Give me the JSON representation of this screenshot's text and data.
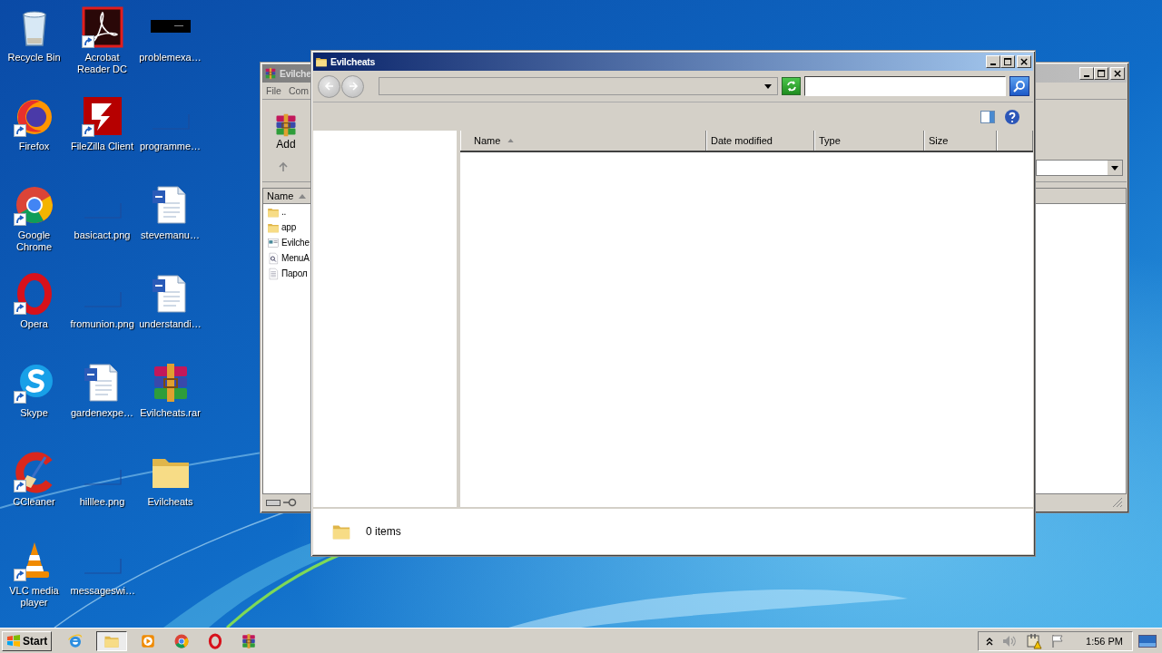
{
  "desktop": {
    "icons": [
      {
        "label": "Recycle Bin",
        "kind": "recycle-bin",
        "shortcut": false
      },
      {
        "label": "Acrobat Reader DC",
        "kind": "pdf",
        "shortcut": true
      },
      {
        "label": "problemexa…",
        "kind": "thumb-dark",
        "shortcut": false
      },
      {
        "label": "Firefox",
        "kind": "fox",
        "shortcut": true
      },
      {
        "label": "FileZilla Client",
        "kind": "ftp",
        "shortcut": true
      },
      {
        "label": "programme…",
        "kind": "thumb",
        "shortcut": false
      },
      {
        "label": "Google Chrome",
        "kind": "chrome",
        "shortcut": true
      },
      {
        "label": "basicact.png",
        "kind": "thumb",
        "shortcut": false
      },
      {
        "label": "stevemanu…",
        "kind": "document",
        "shortcut": false
      },
      {
        "label": "Opera",
        "kind": "opera",
        "shortcut": true
      },
      {
        "label": "fromunion.png",
        "kind": "thumb",
        "shortcut": false
      },
      {
        "label": "understandi…",
        "kind": "document",
        "shortcut": false
      },
      {
        "label": "Skype",
        "kind": "skype",
        "shortcut": true
      },
      {
        "label": "gardenexpe…",
        "kind": "document",
        "shortcut": false
      },
      {
        "label": "Evilcheats.rar",
        "kind": "archive",
        "shortcut": false
      },
      {
        "label": "CCleaner",
        "kind": "cleaner",
        "shortcut": true
      },
      {
        "label": "hilllee.png",
        "kind": "thumb",
        "shortcut": false
      },
      {
        "label": "Evilcheats",
        "kind": "folder",
        "shortcut": false
      },
      {
        "label": "VLC media player",
        "kind": "cone",
        "shortcut": true
      },
      {
        "label": "messageswi…",
        "kind": "thumb",
        "shortcut": false
      }
    ]
  },
  "archive_window": {
    "title": "Evilche",
    "menu": [
      "File",
      "Com"
    ],
    "toolbar_button": "Add",
    "column": "Name",
    "files": [
      {
        "name": "..",
        "kind": "folder"
      },
      {
        "name": "app",
        "kind": "folder"
      },
      {
        "name": "Evilche",
        "kind": "program"
      },
      {
        "name": "MenuA",
        "kind": "link"
      },
      {
        "name": "Парол",
        "kind": "text"
      }
    ]
  },
  "explorer_window": {
    "title": "Evilcheats",
    "columns": [
      {
        "label": "Name",
        "sorted": true
      },
      {
        "label": "Date modified",
        "sorted": false
      },
      {
        "label": "Type",
        "sorted": false
      },
      {
        "label": "Size",
        "sorted": false
      }
    ],
    "status": "0 items"
  },
  "taskbar": {
    "start": "Start",
    "items": [
      {
        "kind": "ie",
        "selected": false
      },
      {
        "kind": "folder",
        "selected": true
      },
      {
        "kind": "media",
        "selected": false
      },
      {
        "kind": "chrome",
        "selected": false
      },
      {
        "kind": "opera",
        "selected": false
      },
      {
        "kind": "archive",
        "selected": false
      }
    ],
    "clock": "1:56 PM"
  }
}
